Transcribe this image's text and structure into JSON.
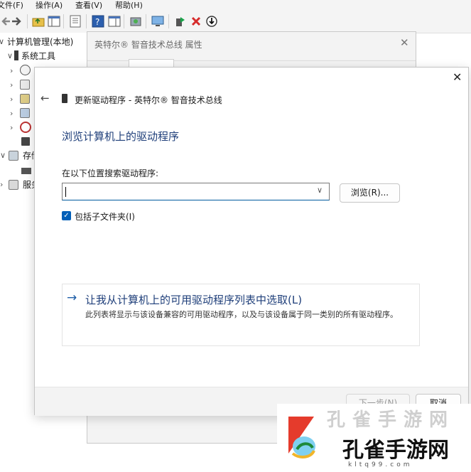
{
  "menubar": {
    "items": [
      {
        "label": "文件(F)"
      },
      {
        "label": "操作(A)"
      },
      {
        "label": "查看(V)"
      },
      {
        "label": "帮助(H)"
      }
    ]
  },
  "toolbar": {
    "icons": [
      "back-arrow-icon",
      "forward-arrow-icon",
      "folder-up-icon",
      "show-hide-tree-icon",
      "properties-icon",
      "help-icon",
      "action-pane-icon",
      "scan-hardware-icon",
      "monitor-icon",
      "enable-device-icon",
      "uninstall-icon",
      "update-driver-icon"
    ]
  },
  "tree": {
    "root_label": "计算机管理(本地)",
    "system_tools_label": "系统工具",
    "storage_label": "存储",
    "services_label": "服务和"
  },
  "properties_dialog": {
    "title": "英特尔® 智音技术总线 属性",
    "close_glyph": "✕"
  },
  "wizard": {
    "close_glyph": "✕",
    "back_glyph": "←",
    "header_title": "更新驱动程序 - 英特尔® 智音技术总线",
    "heading": "浏览计算机上的驱动程序",
    "search_label": "在以下位置搜索驱动程序:",
    "path_value": "",
    "browse_label": "浏览(R)...",
    "include_subfolders_label": "包括子文件夹(I)",
    "include_subfolders_checked": true,
    "pick_arrow": "→",
    "pick_title": "让我从计算机上的可用驱动程序列表中选取(L)",
    "pick_description": "此列表将显示与该设备兼容的可用驱动程序，以及与该设备属于同一类别的所有驱动程序。",
    "next_label": "下一步(N)",
    "cancel_label": "取消"
  },
  "watermark": {
    "brand": "孔雀手游网",
    "domain": "kltq99.com",
    "faint": "孔雀手游网"
  },
  "colors": {
    "accent": "#005fb8",
    "heading": "#1f3f7a"
  }
}
